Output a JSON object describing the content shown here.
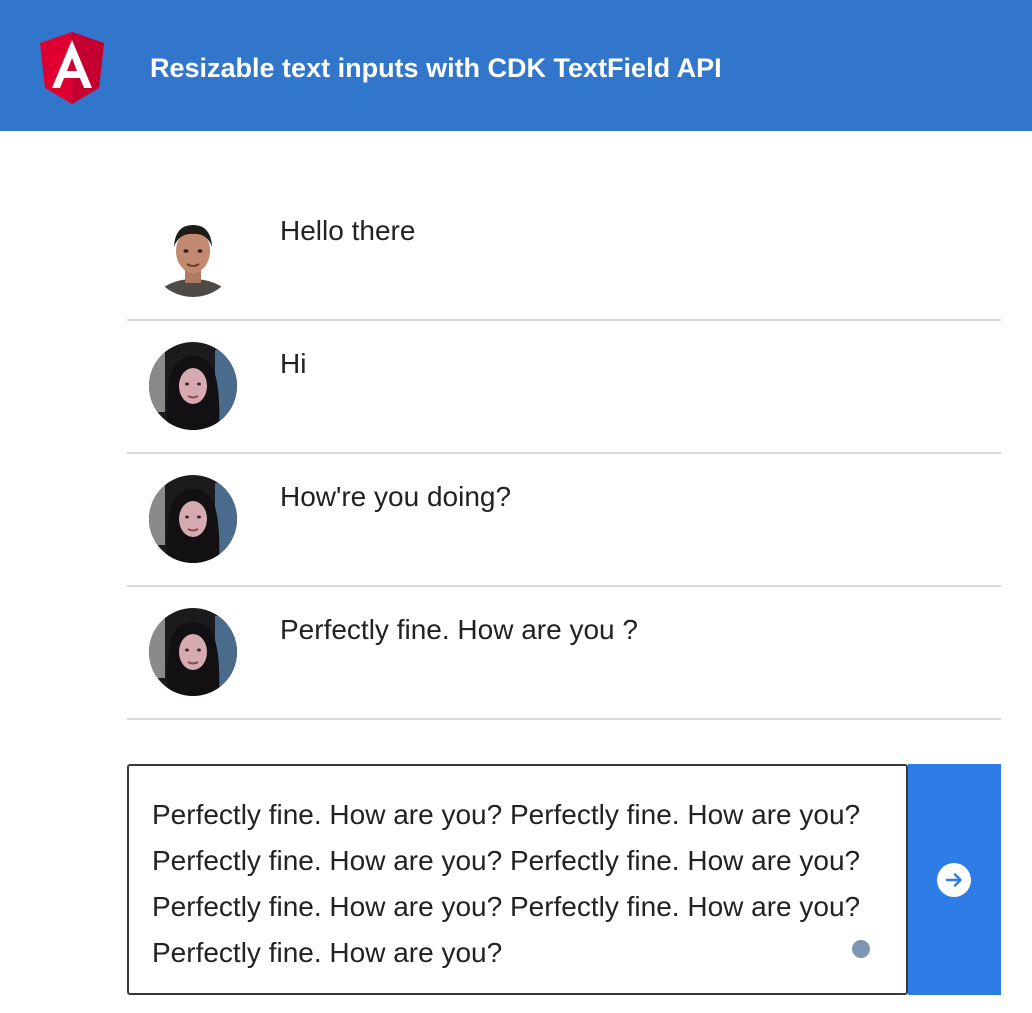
{
  "app": {
    "title": "Resizable text inputs with CDK TextField API",
    "logo_icon": "angular-logo-icon",
    "header_color": "#3276cc"
  },
  "messages": [
    {
      "text": "Hello there",
      "avatar": "avatar-man"
    },
    {
      "text": "Hi",
      "avatar": "avatar-woman"
    },
    {
      "text": "How're you doing?",
      "avatar": "avatar-woman"
    },
    {
      "text": "Perfectly fine. How are you ?",
      "avatar": "avatar-woman"
    }
  ],
  "composer": {
    "value": "Perfectly fine. How are you? Perfectly fine. How are you? Perfectly fine. How are you? Perfectly fine. How are you? Perfectly fine. How are you? Perfectly fine. How are you? Perfectly fine. How are you?",
    "send_icon": "arrow-right-circle-icon",
    "send_color": "#2e7de6"
  }
}
